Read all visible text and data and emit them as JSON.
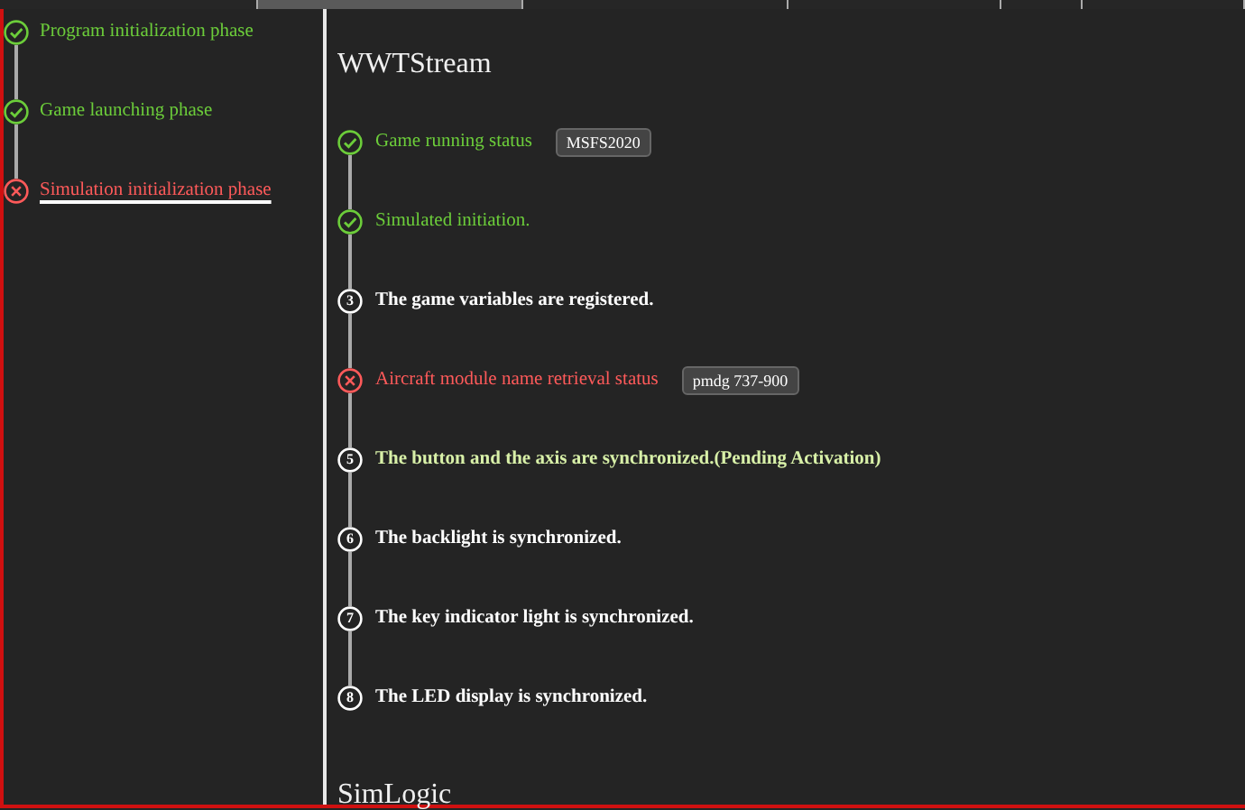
{
  "tabs": [
    {
      "selected": false
    },
    {
      "selected": true
    },
    {
      "selected": false
    },
    {
      "selected": false
    },
    {
      "selected": false
    },
    {
      "selected": false
    }
  ],
  "sidebar": {
    "items": [
      {
        "label": "Program initialization phase",
        "kind": "done",
        "selected": false
      },
      {
        "label": "Game launching phase",
        "kind": "done",
        "selected": false
      },
      {
        "label": "Simulation initialization phase",
        "kind": "error",
        "selected": true
      }
    ]
  },
  "sections": [
    {
      "title": "WWTStream",
      "steps": [
        {
          "kind": "done",
          "label": "Game running status",
          "badge": "MSFS2020"
        },
        {
          "kind": "done",
          "label": "Simulated initiation."
        },
        {
          "kind": "todo",
          "number": "3",
          "label": "The game variables are registered."
        },
        {
          "kind": "error",
          "label": "Aircraft module name retrieval status",
          "badge": "pmdg 737-900"
        },
        {
          "kind": "pending",
          "number": "5",
          "label": "The button and the axis are synchronized.(Pending Activation)"
        },
        {
          "kind": "todo",
          "number": "6",
          "label": "The backlight is synchronized."
        },
        {
          "kind": "todo",
          "number": "7",
          "label": "The key indicator light is synchronized."
        },
        {
          "kind": "todo",
          "number": "8",
          "label": "The LED display is synchronized."
        }
      ]
    },
    {
      "title": "SimLogic"
    }
  ]
}
